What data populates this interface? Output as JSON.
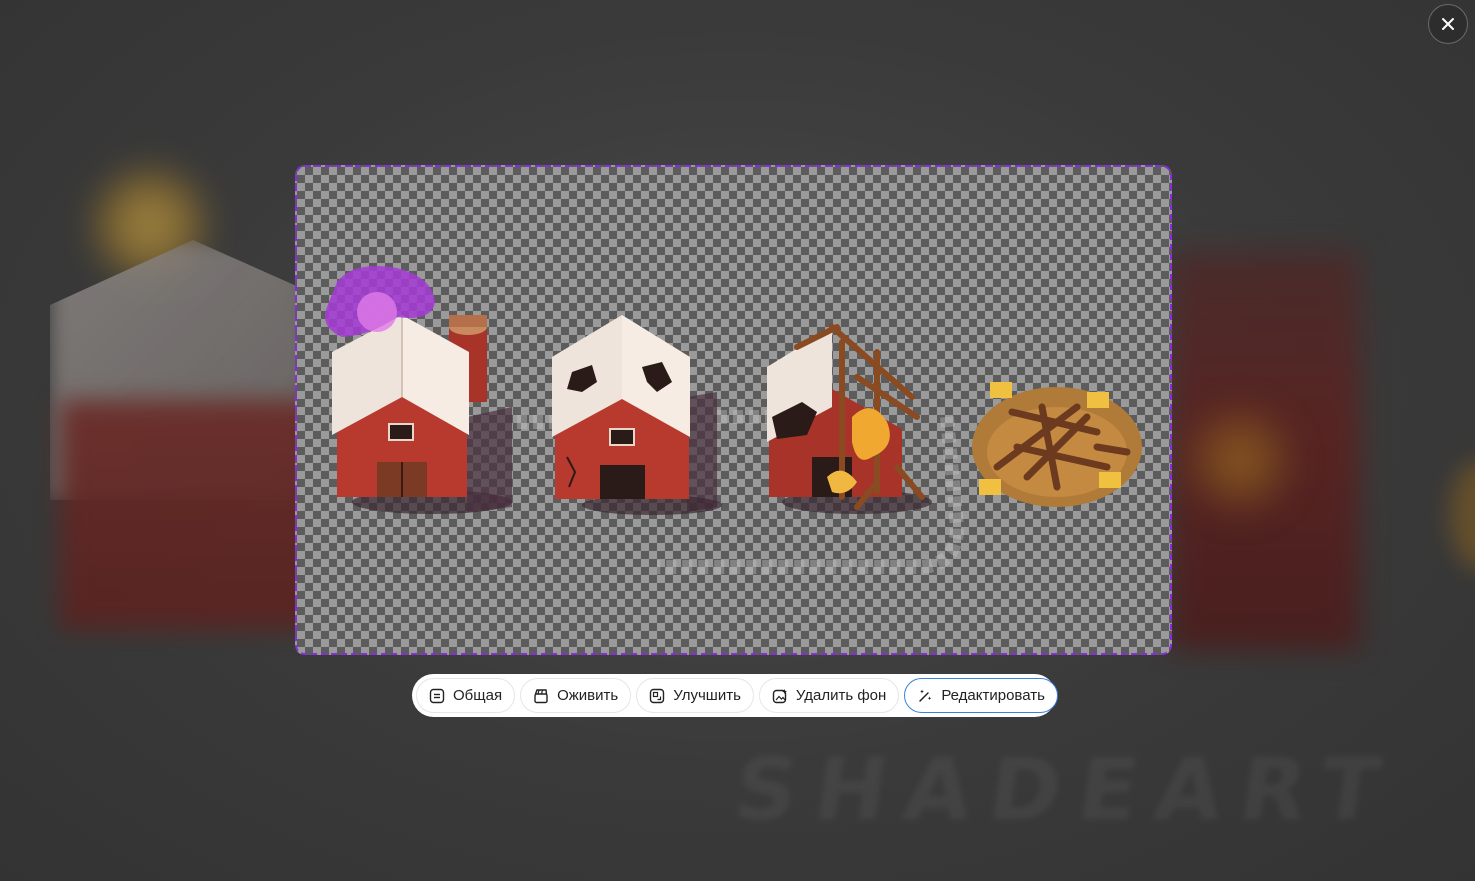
{
  "colors": {
    "selection_border": "#8a2be2",
    "active_button_border": "#3b7fe0",
    "toolbar_bg": "#ffffff",
    "overlay_bg": "#3b3b3b"
  },
  "close_button": {
    "icon": "close-icon"
  },
  "toolbar": {
    "buttons": [
      {
        "label": "Общая",
        "icon": "share-icon"
      },
      {
        "label": "Оживить",
        "icon": "animate-icon"
      },
      {
        "label": "Улучшить",
        "icon": "enhance-icon"
      },
      {
        "label": "Удалить фон",
        "icon": "remove-bg-icon"
      },
      {
        "label": "Редактировать",
        "icon": "magic-wand-icon",
        "active": true
      }
    ]
  }
}
